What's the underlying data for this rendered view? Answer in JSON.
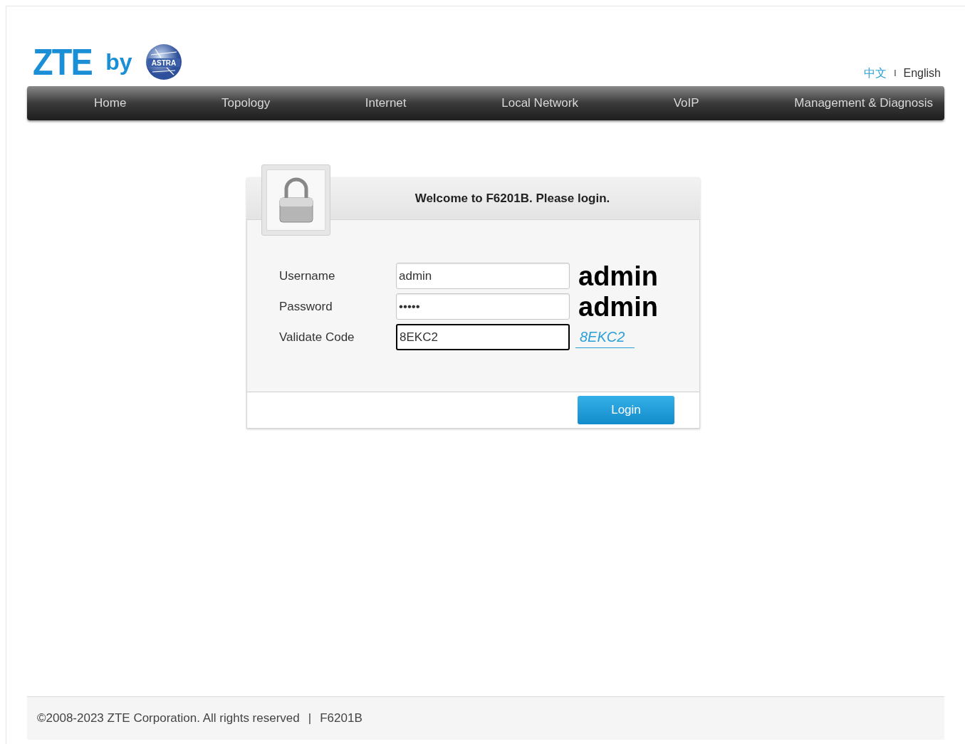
{
  "logo": {
    "brand": "ZTE",
    "by": "by",
    "badge": "ASTRA"
  },
  "languages": [
    {
      "label": "中文",
      "selected": false
    },
    {
      "label": "English",
      "selected": true
    }
  ],
  "language_separator": "I",
  "nav": [
    {
      "label": "Home"
    },
    {
      "label": "Topology"
    },
    {
      "label": "Internet"
    },
    {
      "label": "Local Network"
    },
    {
      "label": "VoIP"
    },
    {
      "label": "Management & Diagnosis"
    }
  ],
  "login": {
    "title": "Welcome to F6201B. Please login.",
    "fields": [
      {
        "label": "Username",
        "value": "admin",
        "focused": false,
        "note": "admin",
        "kind": "note"
      },
      {
        "label": "Password",
        "value": "•••••",
        "focused": false,
        "note": "admin",
        "kind": "note"
      },
      {
        "label": "Validate Code",
        "value": "8EKC2",
        "focused": true,
        "note": "8EKC2",
        "kind": "captcha"
      }
    ],
    "button": "Login"
  },
  "footer": {
    "copyright": "©2008-2023 ZTE Corporation. All rights reserved",
    "separator": "|",
    "model": "F6201B"
  }
}
